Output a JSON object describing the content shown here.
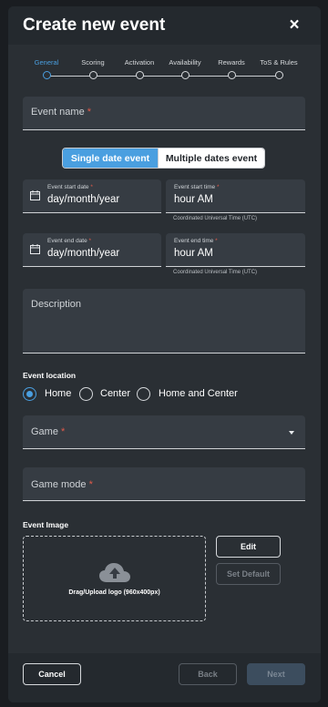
{
  "modal": {
    "title": "Create new event",
    "close_glyph": "×"
  },
  "stepper": {
    "steps": [
      {
        "label": "General",
        "active": true
      },
      {
        "label": "Scoring",
        "active": false
      },
      {
        "label": "Activation",
        "active": false
      },
      {
        "label": "Availability",
        "active": false
      },
      {
        "label": "Rewards",
        "active": false
      },
      {
        "label": "ToS & Rules",
        "active": false
      }
    ]
  },
  "event_name": {
    "label": "Event name",
    "required": "*"
  },
  "date_mode": {
    "single": "Single date event",
    "multiple": "Multiple dates event",
    "selected": "single"
  },
  "start_date": {
    "label": "Event start date",
    "required": "*",
    "value": "day/month/year"
  },
  "start_time": {
    "label": "Event start time",
    "required": "*",
    "value": "hour AM",
    "helper": "Coordinated Universal Time (UTC)"
  },
  "end_date": {
    "label": "Event end date",
    "required": "*",
    "value": "day/month/year"
  },
  "end_time": {
    "label": "Event end time",
    "required": "*",
    "value": "hour AM",
    "helper": "Coordinated Universal Time (UTC)"
  },
  "description": {
    "label": "Description"
  },
  "location": {
    "heading": "Event location",
    "options": [
      "Home",
      "Center",
      "Home and Center"
    ],
    "selected": "Home"
  },
  "game": {
    "label": "Game",
    "required": "*"
  },
  "game_mode": {
    "label": "Game mode",
    "required": "*"
  },
  "image": {
    "heading": "Event Image",
    "dropzone_text": "Drag/Upload logo (960x400px)",
    "edit_label": "Edit",
    "set_default_label": "Set Default"
  },
  "footer": {
    "cancel_label": "Cancel",
    "back_label": "Back",
    "next_label": "Next"
  },
  "colors": {
    "accent": "#4a9fe0",
    "required": "#e05a4a",
    "modal_bg": "#2a2f34",
    "field_bg": "#363c43"
  },
  "icons": [
    "close-icon",
    "calendar-icon",
    "chevron-down-icon",
    "cloud-upload-icon"
  ]
}
